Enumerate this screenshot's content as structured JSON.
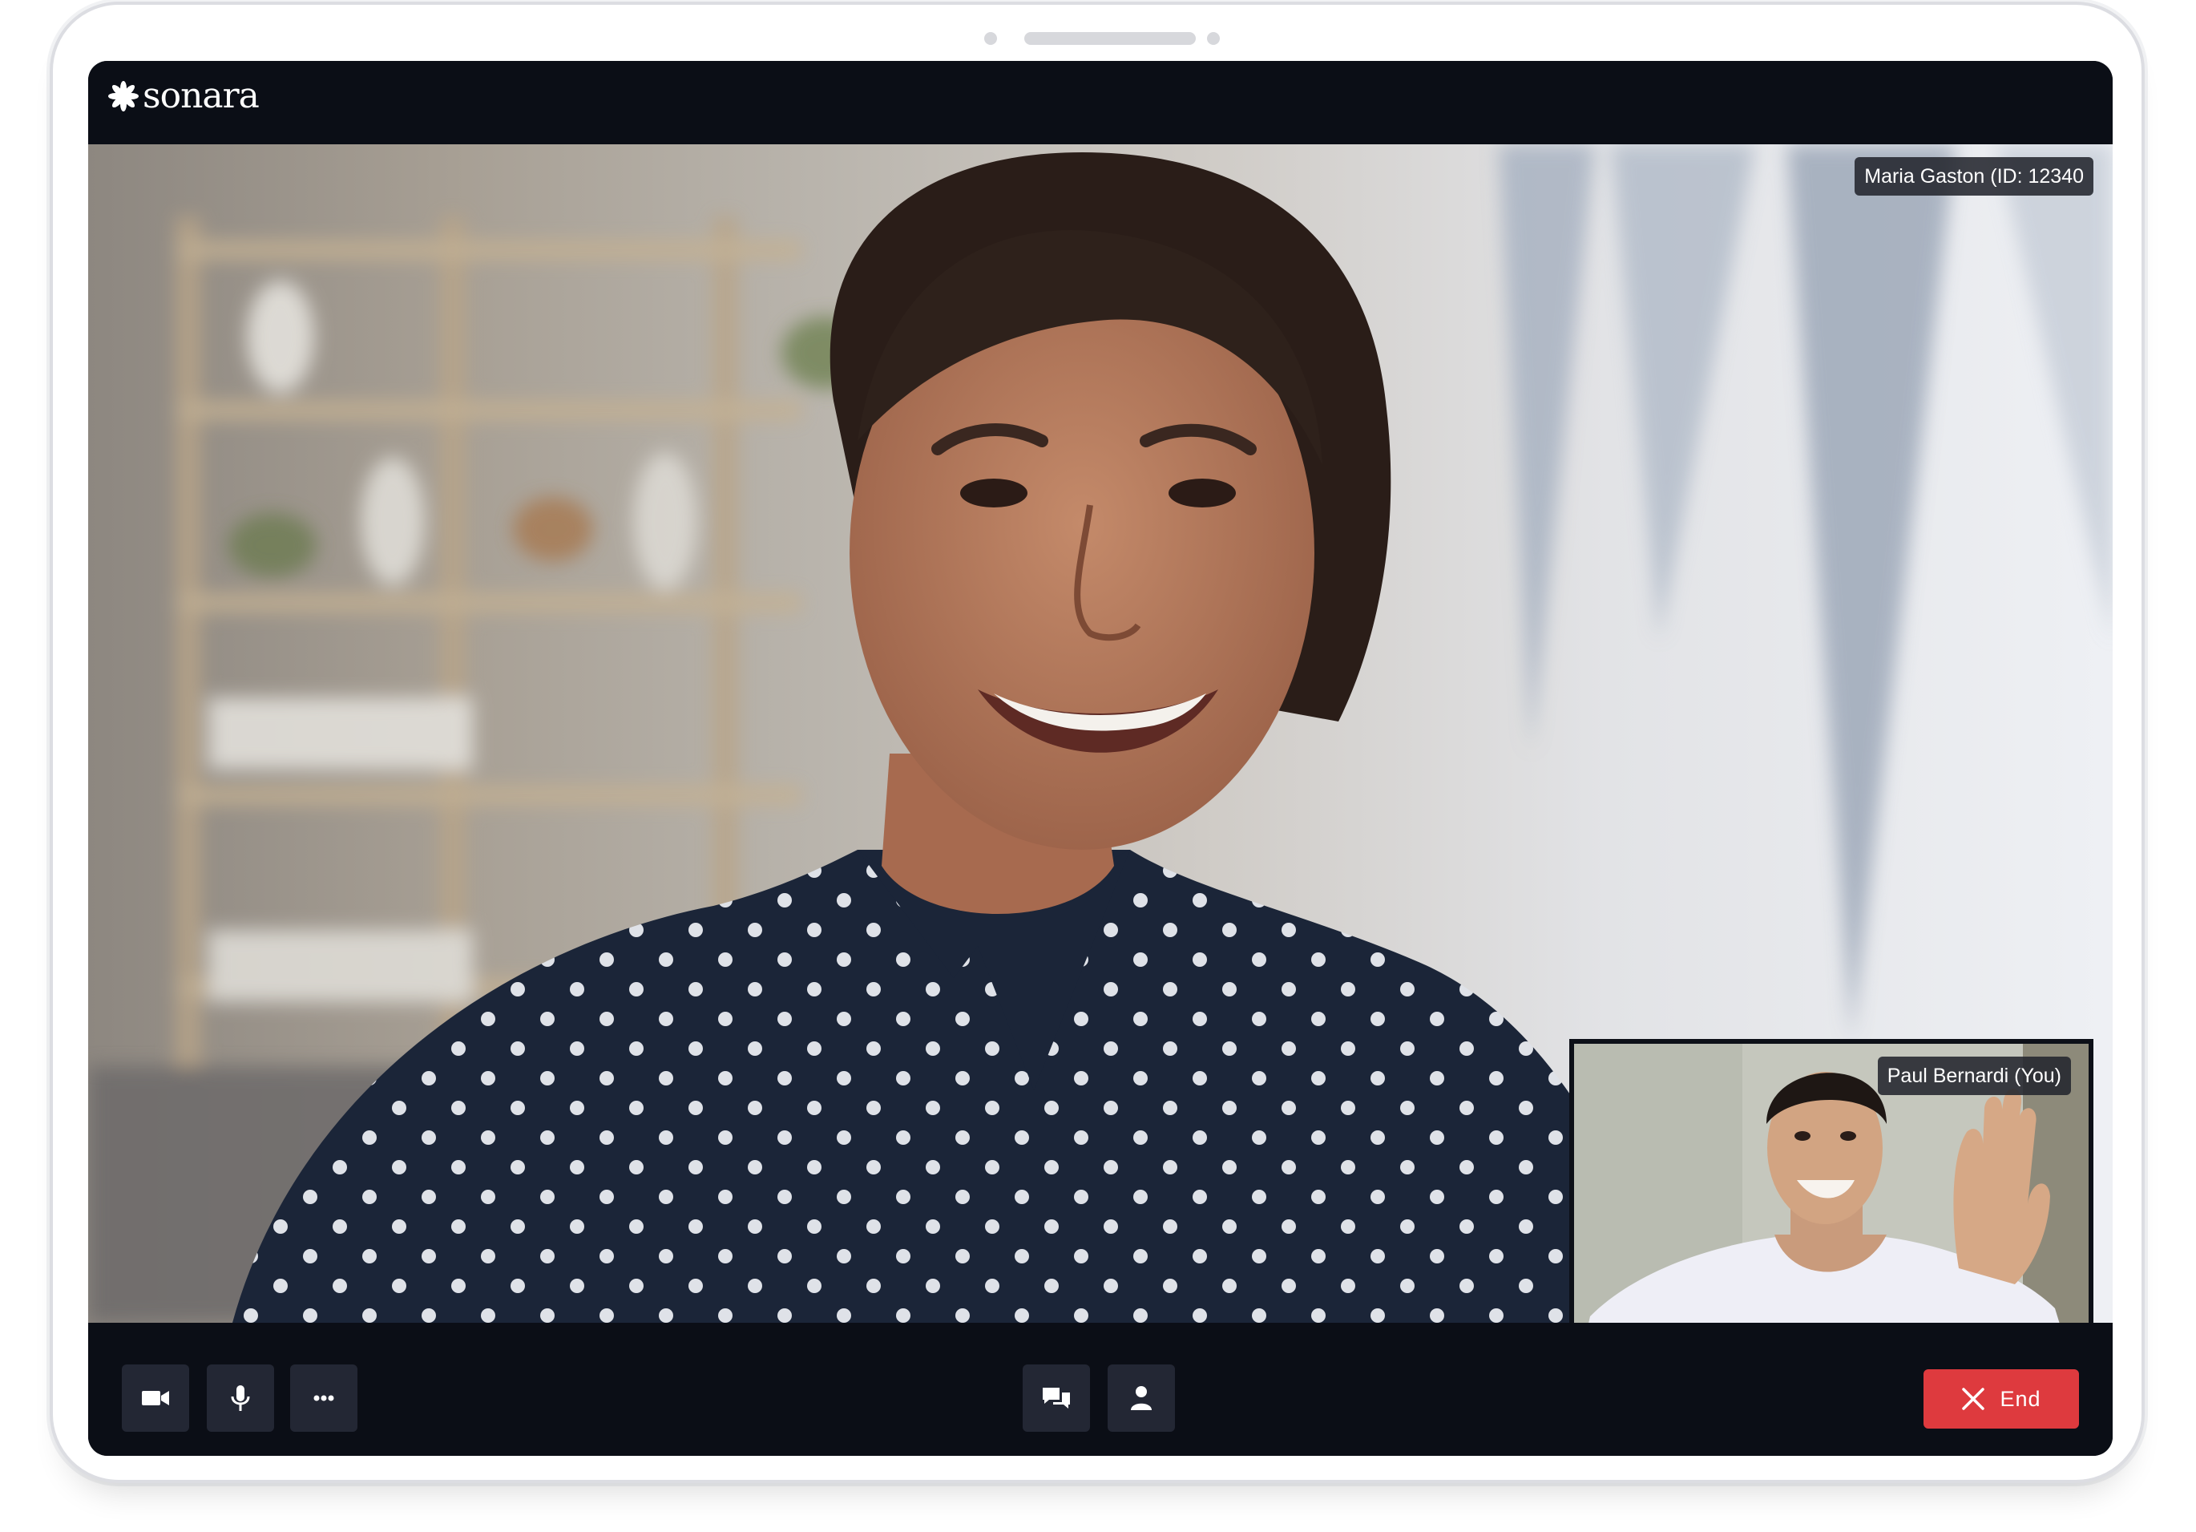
{
  "app": {
    "brand": "sonara",
    "logo_icon": "asterisk-flower-icon"
  },
  "call": {
    "remote_participant_label": "Maria Gaston (ID: 12340",
    "self_participant_label": "Paul Bernardi (You)"
  },
  "controls": {
    "left": [
      {
        "name": "camera-button",
        "icon": "video-camera-icon"
      },
      {
        "name": "microphone-button",
        "icon": "microphone-icon"
      },
      {
        "name": "more-options-button",
        "icon": "ellipsis-icon"
      }
    ],
    "center": [
      {
        "name": "chat-button",
        "icon": "chat-bubbles-icon"
      },
      {
        "name": "participants-button",
        "icon": "person-icon"
      }
    ],
    "end_label": "End",
    "end_icon": "close-x-icon"
  },
  "colors": {
    "app_background": "#0b0e16",
    "control_button": "#232734",
    "end_button": "#de3a3e",
    "label_background": "#23262e"
  }
}
